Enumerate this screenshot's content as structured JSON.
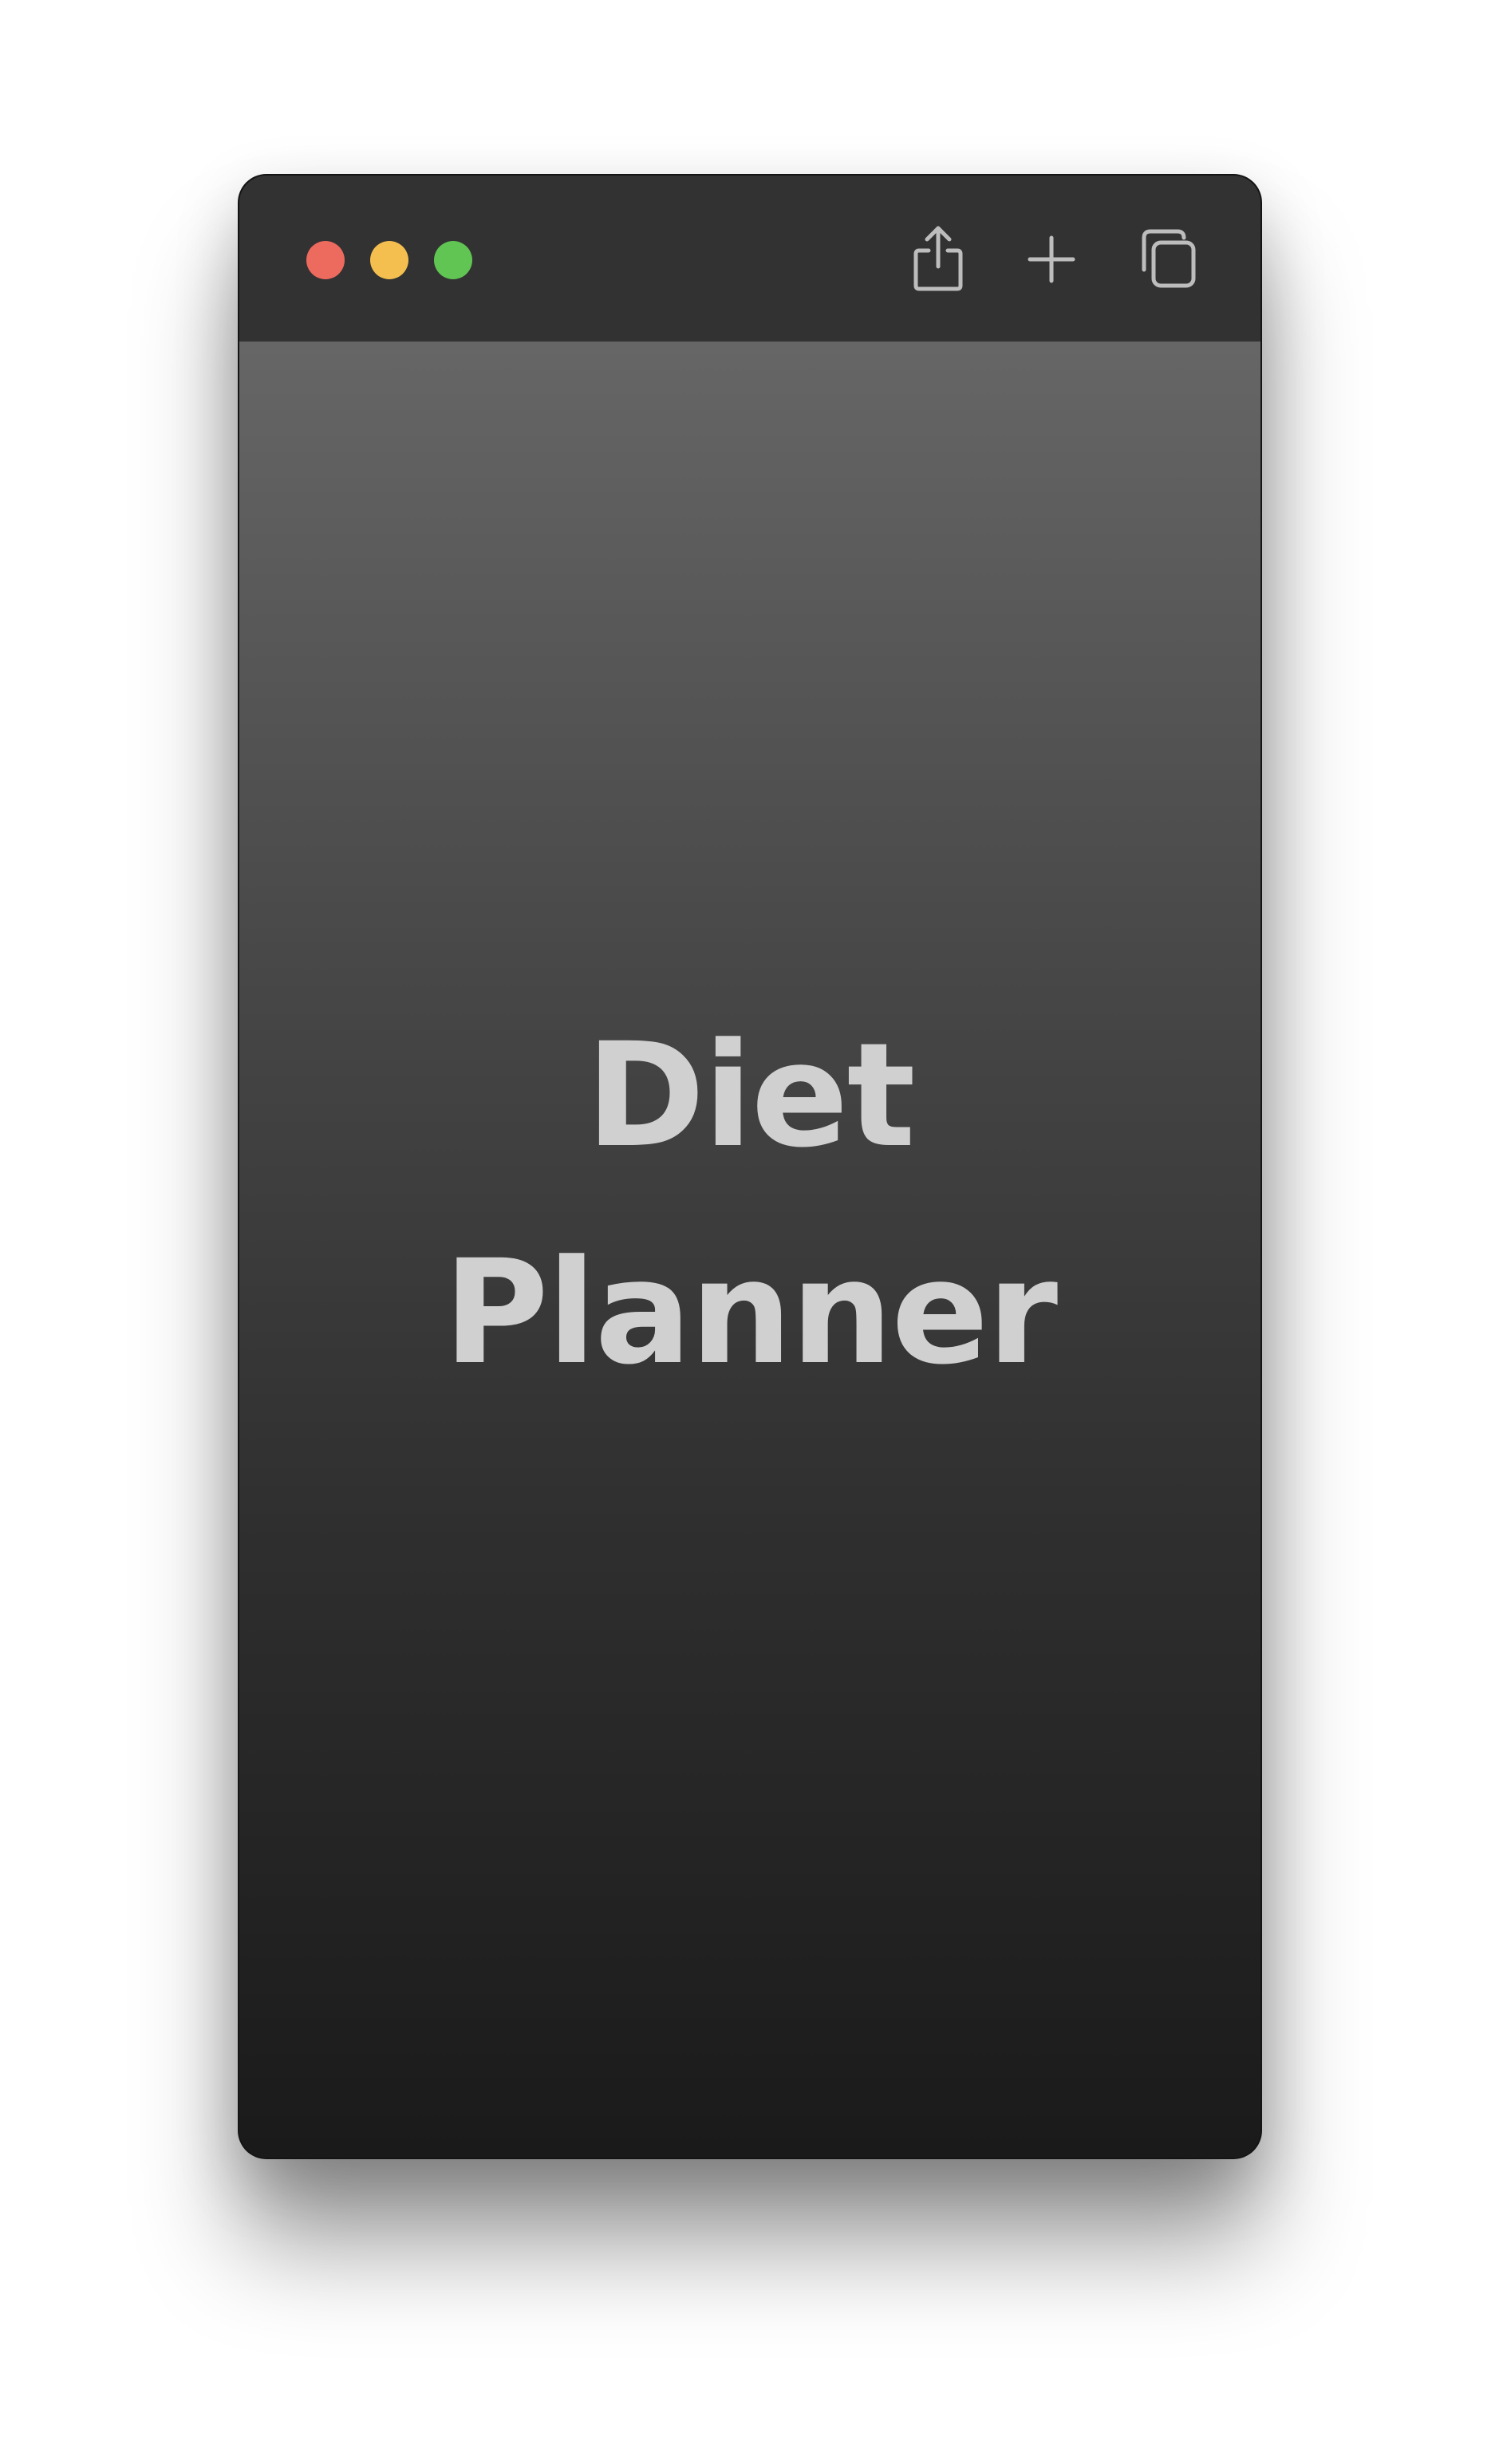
{
  "window": {
    "traffic_lights": {
      "close_color": "#ed6a5e",
      "minimize_color": "#f5bf4f",
      "zoom_color": "#61c554"
    },
    "toolbar": {
      "share_icon": "share-icon",
      "new_tab_icon": "plus-icon",
      "tabs_overview_icon": "tabs-overview-icon"
    }
  },
  "content": {
    "title_line_1": "Diet",
    "title_line_2": "Planner",
    "title_color": "#d0d0d0"
  }
}
